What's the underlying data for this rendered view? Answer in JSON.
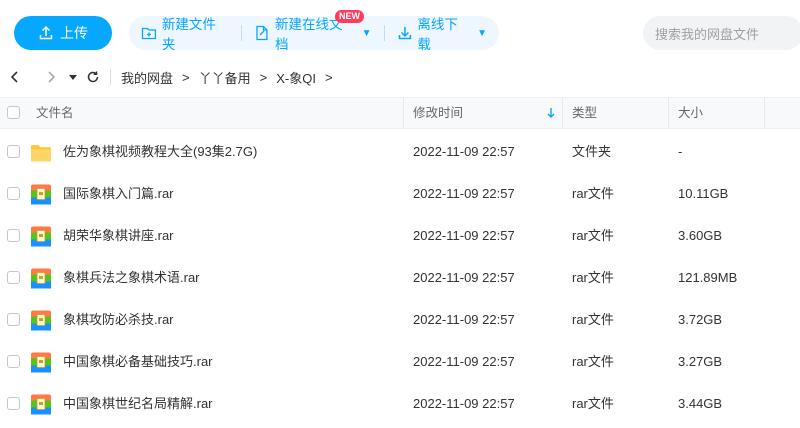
{
  "toolbar": {
    "upload_label": "上传",
    "new_folder_label": "新建文件夹",
    "new_doc_label": "新建在线文档",
    "new_badge": "NEW",
    "offline_label": "离线下载",
    "search_placeholder": "搜索我的网盘文件"
  },
  "breadcrumb": {
    "items": [
      "我的网盘",
      "丫丫备用",
      "X-象QI"
    ],
    "separator": ">"
  },
  "table": {
    "columns": {
      "name": "文件名",
      "modified": "修改时间",
      "type": "类型",
      "size": "大小"
    },
    "rows": [
      {
        "name": "佐为象棋视频教程大全(93集2.7G)",
        "modified": "2022-11-09 22:57",
        "type": "文件夹",
        "size": "-",
        "icon": "folder-icon"
      },
      {
        "name": "国际象棋入门篇.rar",
        "modified": "2022-11-09 22:57",
        "type": "rar文件",
        "size": "10.11GB",
        "icon": "rar-icon"
      },
      {
        "name": "胡荣华象棋讲座.rar",
        "modified": "2022-11-09 22:57",
        "type": "rar文件",
        "size": "3.60GB",
        "icon": "rar-icon"
      },
      {
        "name": "象棋兵法之象棋术语.rar",
        "modified": "2022-11-09 22:57",
        "type": "rar文件",
        "size": "121.89MB",
        "icon": "rar-icon"
      },
      {
        "name": "象棋攻防必杀技.rar",
        "modified": "2022-11-09 22:57",
        "type": "rar文件",
        "size": "3.72GB",
        "icon": "rar-icon"
      },
      {
        "name": "中国象棋必备基础技巧.rar",
        "modified": "2022-11-09 22:57",
        "type": "rar文件",
        "size": "3.27GB",
        "icon": "rar-icon"
      },
      {
        "name": "中国象棋世纪名局精解.rar",
        "modified": "2022-11-09 22:57",
        "type": "rar文件",
        "size": "3.44GB",
        "icon": "rar-icon"
      }
    ]
  },
  "colors": {
    "accent": "#06a7ff",
    "folder": "#ffc53d",
    "badge": "#ff3b5c"
  }
}
